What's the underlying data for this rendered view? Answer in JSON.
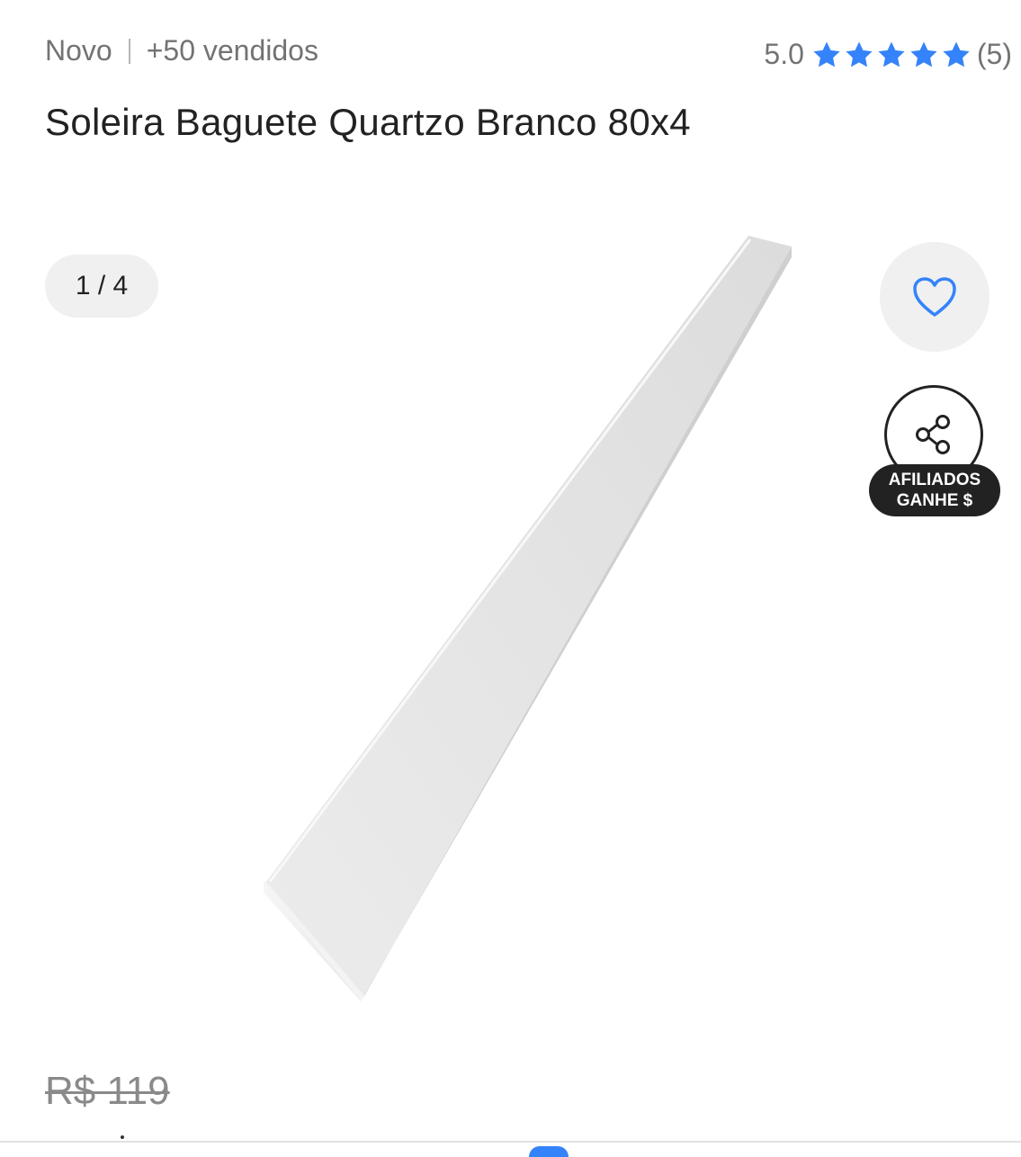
{
  "meta": {
    "condition": "Novo",
    "sold": "+50 vendidos"
  },
  "rating": {
    "score": "5.0",
    "stars": 5,
    "count": "(5)",
    "star_color": "#3483fa"
  },
  "product": {
    "title": "Soleira Baguete Quartzo Branco 80x4"
  },
  "gallery": {
    "counter": "1 / 4",
    "image_icon": "product-image"
  },
  "actions": {
    "favorite_icon": "heart-icon",
    "share_icon": "share-icon",
    "affiliate_line1": "AFILIADOS",
    "affiliate_line2": "GANHE $"
  },
  "price": {
    "original": "R$ 119"
  },
  "colors": {
    "accent": "#3483fa",
    "text": "#333333",
    "muted": "#737373"
  }
}
